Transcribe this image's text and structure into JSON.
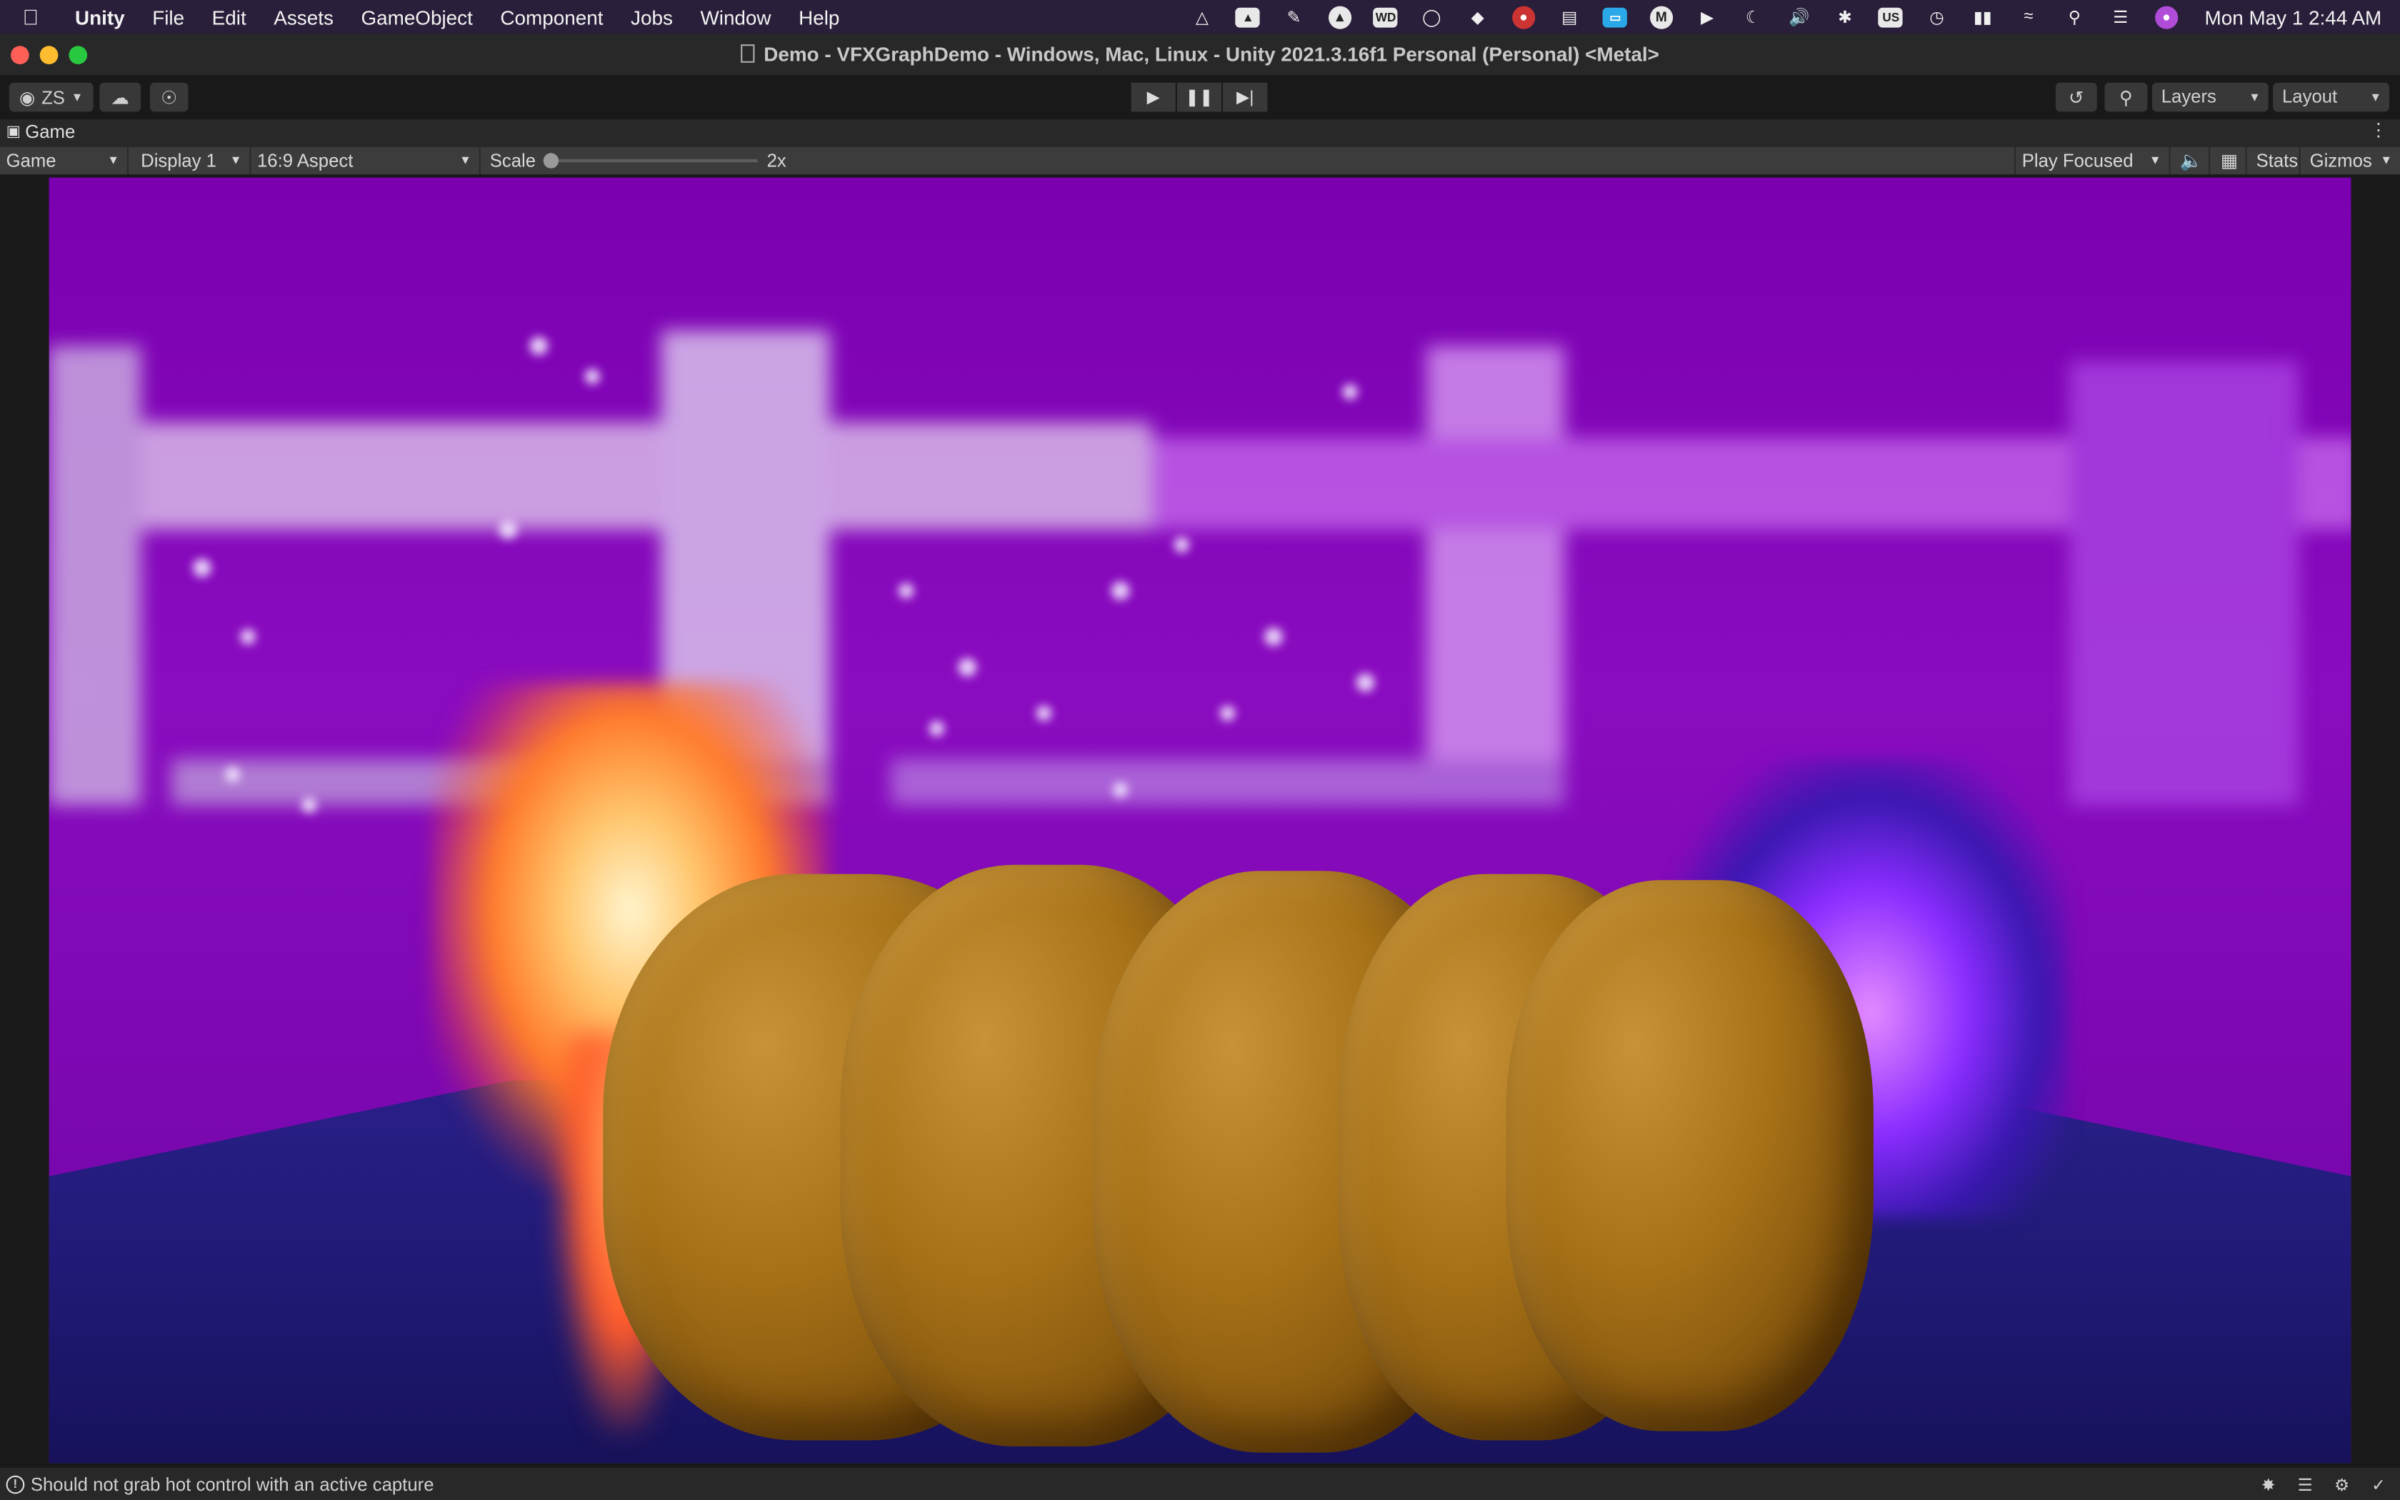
{
  "menubar": {
    "app_name": "Unity",
    "items": [
      "File",
      "Edit",
      "Assets",
      "GameObject",
      "Component",
      "Jobs",
      "Window",
      "Help"
    ],
    "clock": "Mon May 1  2:44 AM",
    "status_icons": [
      "unity-icon",
      "drive-icon",
      "pencil-icon",
      "alarm-icon",
      "wd-icon",
      "creative-cloud-icon",
      "cube-icon",
      "record-icon",
      "chart-icon",
      "window-icon",
      "m-icon",
      "play-circle-icon",
      "moon-icon",
      "volume-icon",
      "bluetooth-icon",
      "input-source-icon",
      "time-machine-icon",
      "battery-icon",
      "wifi-icon",
      "search-icon",
      "control-center-icon",
      "siri-icon"
    ],
    "input_source_label": "US",
    "wd_label": "WD"
  },
  "window": {
    "title": "Demo - VFXGraphDemo - Windows, Mac, Linux - Unity 2021.3.16f1 Personal (Personal) <Metal>"
  },
  "toolbar": {
    "account_label": "ZS",
    "layers_label": "Layers",
    "layout_label": "Layout"
  },
  "tab": {
    "label": "Game"
  },
  "gamebar": {
    "view_select": "Game",
    "display_select": "Display 1",
    "aspect_select": "16:9 Aspect",
    "scale_label": "Scale",
    "scale_value": "2x",
    "play_mode_select": "Play Focused",
    "stats_label": "Stats",
    "gizmos_label": "Gizmos"
  },
  "console": {
    "message": "Should not grab hot control with an active capture"
  },
  "colors": {
    "scene_bg": "#8a0cc0",
    "floor": "#201a76",
    "letters": "#a87218",
    "fire": "#ffc46a",
    "lightning": "#b05cff"
  }
}
